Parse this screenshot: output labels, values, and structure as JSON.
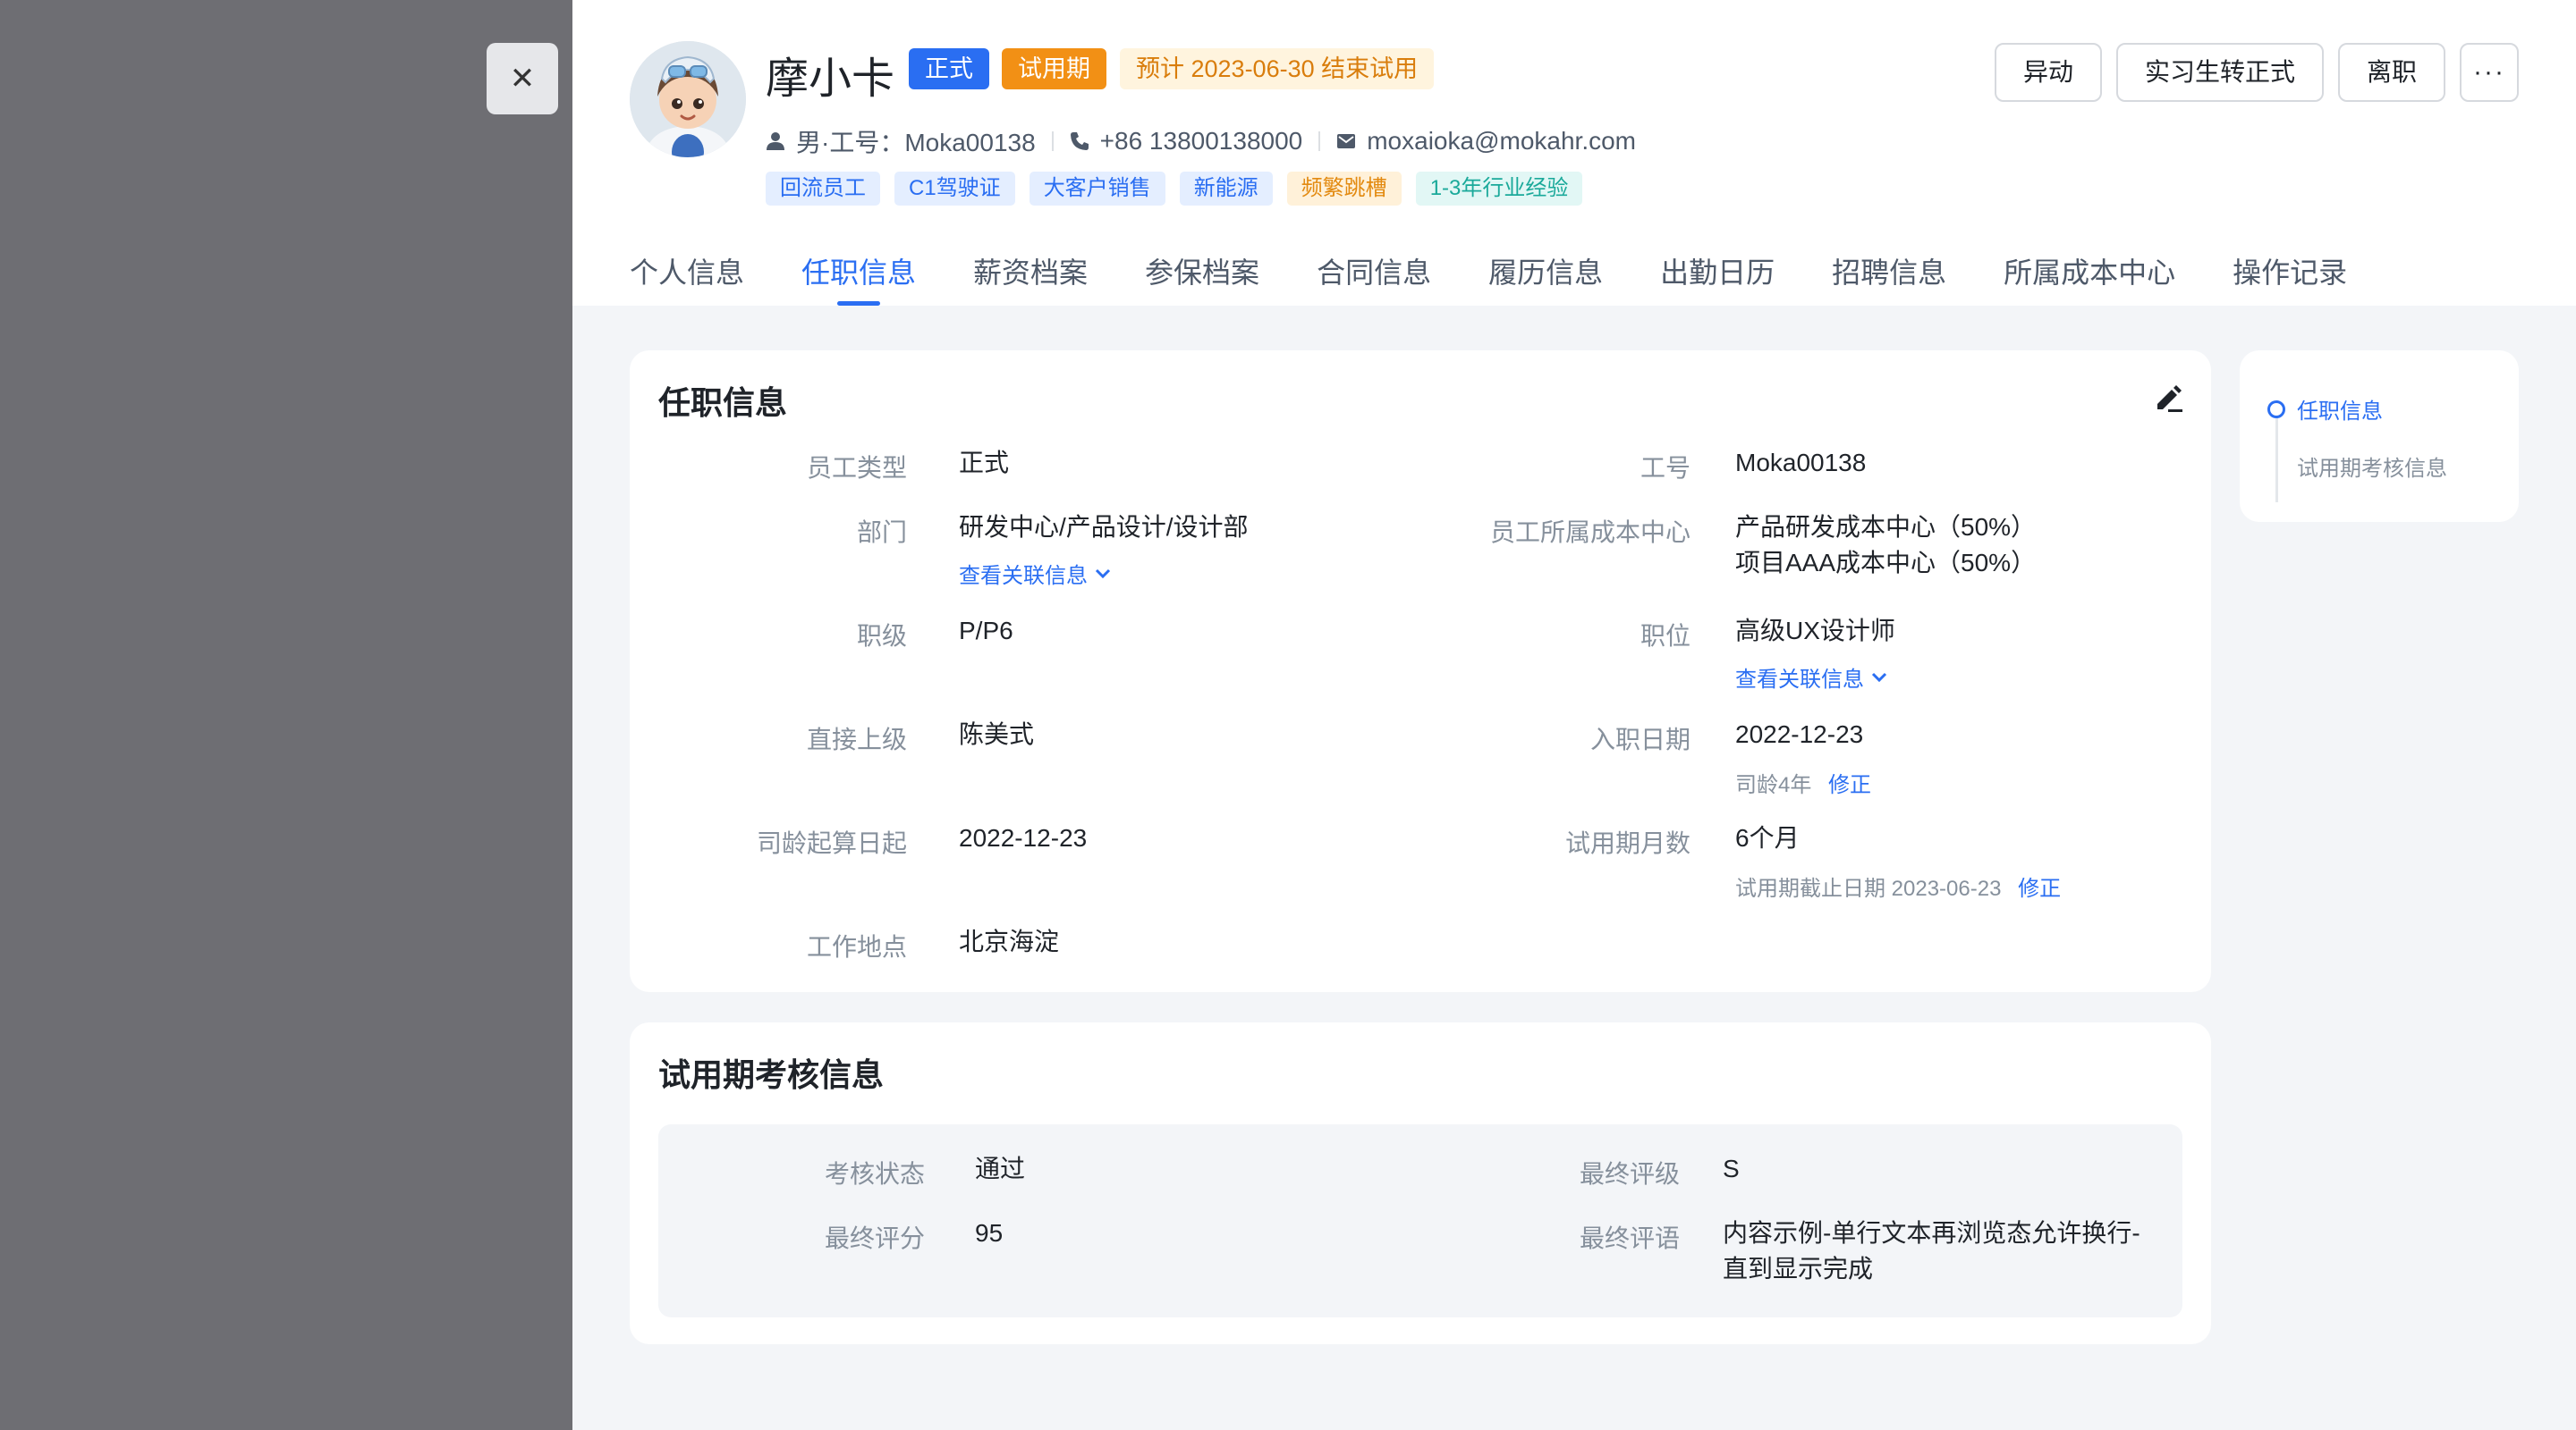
{
  "overlay": {
    "close_symbol": "✕"
  },
  "employee": {
    "name": "摩小卡",
    "status_tag": "正式",
    "trial_tag": "试用期",
    "trial_note": "预计 2023-06-30 结束试用",
    "gender_id": "男·工号：Moka00138",
    "phone": "+86 13800138000",
    "email": "moxaioka@mokahr.com",
    "chips": [
      "回流员工",
      "C1驾驶证",
      "大客户销售",
      "新能源",
      "频繁跳槽",
      "1-3年行业经验"
    ]
  },
  "actions": {
    "transfer": "异动",
    "convert": "实习生转正式",
    "resign": "离职",
    "more": "···"
  },
  "tabs": [
    "个人信息",
    "任职信息",
    "薪资档案",
    "参保档案",
    "合同信息",
    "履历信息",
    "出勤日历",
    "招聘信息",
    "所属成本中心",
    "操作记录"
  ],
  "job": {
    "title": "任职信息",
    "fields": {
      "employee_type_label": "员工类型",
      "employee_type": "正式",
      "employee_no_label": "工号",
      "employee_no": "Moka00138",
      "department_label": "部门",
      "department": "研发中心/产品设计/设计部",
      "cost_center_label": "员工所属成本中心",
      "cost_center_1": "产品研发成本中心（50%）",
      "cost_center_2": "项目AAA成本中心（50%）",
      "rank_label": "职级",
      "rank": "P/P6",
      "position_label": "职位",
      "position": "高级UX设计师",
      "manager_label": "直接上级",
      "manager": "陈美式",
      "hire_date_label": "入职日期",
      "hire_date": "2022-12-23",
      "tenure_note": "司龄4年",
      "tenure_start_label": "司龄起算日起",
      "tenure_start": "2022-12-23",
      "trial_months_label": "试用期月数",
      "trial_months": "6个月",
      "trial_end_note": "试用期截止日期 2023-06-23",
      "location_label": "工作地点",
      "location": "北京海淀"
    },
    "related_link": "查看关联信息",
    "fix_link": "修正"
  },
  "review": {
    "title": "试用期考核信息",
    "status_label": "考核状态",
    "status": "通过",
    "grade_label": "最终评级",
    "grade": "S",
    "score_label": "最终评分",
    "score": "95",
    "comment_label": "最终评语",
    "comment_line1": "内容示例-单行文本再浏览态允许换行-",
    "comment_line2": "直到显示完成"
  },
  "anchor_nav": {
    "items": [
      "任职信息",
      "试用期考核信息"
    ]
  },
  "colors": {
    "primary": "#2a6ef2",
    "orange": "#f29015",
    "overlay": "#6e6e73"
  }
}
